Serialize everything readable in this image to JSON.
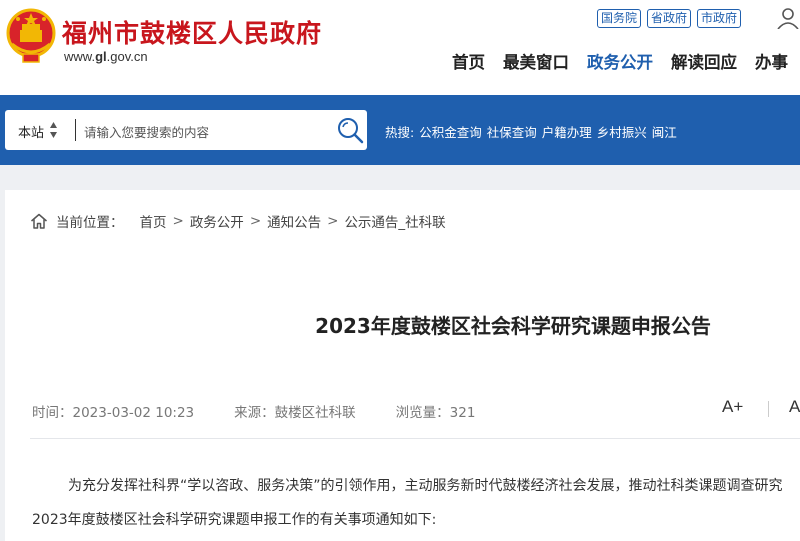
{
  "header": {
    "site_name": "福州市鼓楼区人民政府",
    "site_url_prefix": "www.",
    "site_url_bold": "gl",
    "site_url_suffix": ".gov.cn",
    "emblem_icon": "national-emblem-icon",
    "top_links": [
      "国务院",
      "省政府",
      "市政府"
    ],
    "user_icon": "user-icon",
    "nav": [
      "首页",
      "最美窗口",
      "政务公开",
      "解读回应",
      "办事"
    ],
    "nav_active": "政务公开"
  },
  "search": {
    "scope": "本站",
    "placeholder": "请输入您要搜索的内容",
    "icon": "search-icon",
    "hot_label": "热搜:",
    "hot_items": [
      "公积金查询",
      "社保查询",
      "户籍办理",
      "乡村振兴",
      "闽江"
    ]
  },
  "breadcrumb": {
    "label": "当前位置：",
    "items": [
      "首页",
      "政务公开",
      "通知公告",
      "公示通告_社科联"
    ],
    "separator": ">"
  },
  "article": {
    "title": "2023年度鼓楼区社会科学研究课题申报公告",
    "time": "时间：2023-03-02 10:23",
    "source": "来源：鼓楼区社科联",
    "views": "浏览量：321",
    "font_increase": "A+",
    "font_decrease": "A-",
    "para_line1": "为充分发挥社科界“学以咨政、服务决策”的引领作用，主动服务新时代鼓楼经济社会发展，推动社科类课题调查研究",
    "para_line2": "2023年度鼓楼区社会科学研究课题申报工作的有关事项通知如下:"
  },
  "colors": {
    "brand_red": "#c8161d",
    "brand_blue": "#1f5fae",
    "page_gray": "#eef0f3"
  }
}
